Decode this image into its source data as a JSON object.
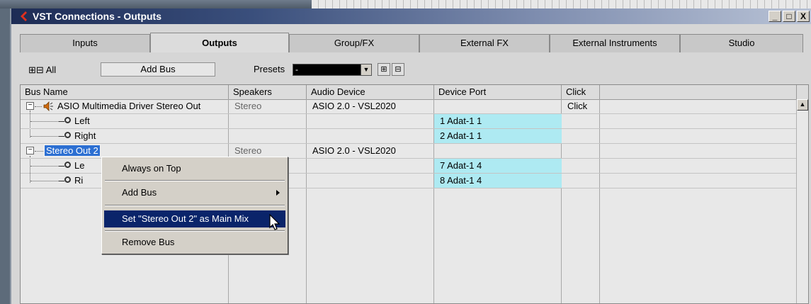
{
  "window": {
    "title": "VST Connections - Outputs",
    "controls": {
      "minimize": "_",
      "maximize": "□",
      "close": "X"
    }
  },
  "tabs": [
    {
      "label": "Inputs",
      "active": false
    },
    {
      "label": "Outputs",
      "active": true
    },
    {
      "label": "Group/FX",
      "active": false
    },
    {
      "label": "External FX",
      "active": false
    },
    {
      "label": "External Instruments",
      "active": false
    },
    {
      "label": "Studio",
      "active": false
    }
  ],
  "toolbar": {
    "expand_all_label": "All",
    "expand_icons": "⊞⊟",
    "add_bus_label": "Add Bus",
    "presets_label": "Presets",
    "presets_value": "-"
  },
  "table": {
    "headers": {
      "bus_name": "Bus Name",
      "speakers": "Speakers",
      "audio_device": "Audio Device",
      "device_port": "Device Port",
      "click": "Click"
    },
    "rows": [
      {
        "name": "ASIO Multimedia Driver Stereo Out",
        "speakers": "Stereo",
        "device": "ASIO 2.0 - VSL2020",
        "port": "",
        "click": "Click"
      },
      {
        "name": "Left",
        "speakers": "",
        "device": "",
        "port": "1 Adat-1 1",
        "click": ""
      },
      {
        "name": "Right",
        "speakers": "",
        "device": "",
        "port": "2 Adat-1 1",
        "click": ""
      },
      {
        "name": "Stereo Out 2",
        "speakers": "Stereo",
        "device": "ASIO 2.0 - VSL2020",
        "port": "",
        "click": ""
      },
      {
        "name": "Le",
        "speakers": "",
        "device": "",
        "port": "7 Adat-1 4",
        "click": ""
      },
      {
        "name": "Ri",
        "speakers": "",
        "device": "",
        "port": "8 Adat-1 4",
        "click": ""
      }
    ]
  },
  "context_menu": {
    "items": [
      {
        "label": "Always on Top"
      },
      {
        "label": "Add Bus"
      },
      {
        "label": "Set \"Stereo Out 2\" as Main Mix"
      },
      {
        "label": "Remove Bus"
      }
    ]
  },
  "colors": {
    "port_cell": "#aeeaf2",
    "menu_highlight": "#0a246a",
    "title_bar": "#1d2c55"
  }
}
